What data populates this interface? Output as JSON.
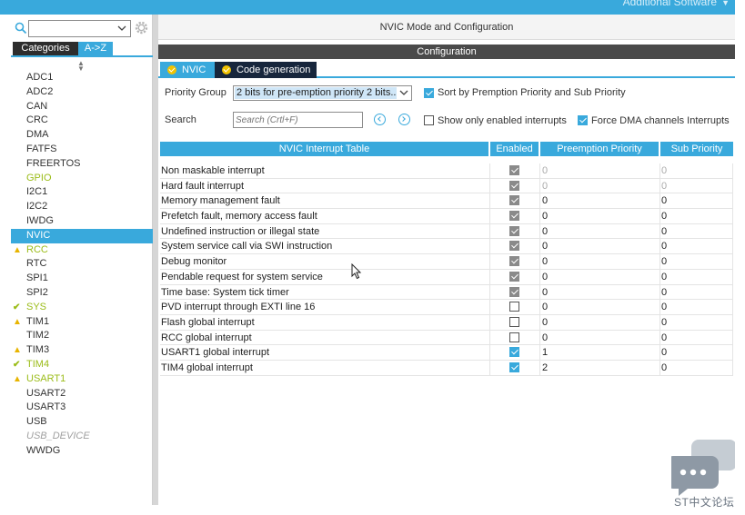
{
  "top_bar": {
    "ghost_text": "Additional Software"
  },
  "left_panel": {
    "search_value": "",
    "tabs": [
      {
        "label": "Categories",
        "active": false
      },
      {
        "label": "A->Z",
        "active": true
      }
    ],
    "peripherals": [
      {
        "label": "ADC1",
        "status": "none"
      },
      {
        "label": "ADC2",
        "status": "none"
      },
      {
        "label": "CAN",
        "status": "none"
      },
      {
        "label": "CRC",
        "status": "none"
      },
      {
        "label": "DMA",
        "status": "none"
      },
      {
        "label": "FATFS",
        "status": "none"
      },
      {
        "label": "FREERTOS",
        "status": "none"
      },
      {
        "label": "GPIO",
        "status": "green"
      },
      {
        "label": "I2C1",
        "status": "none"
      },
      {
        "label": "I2C2",
        "status": "none"
      },
      {
        "label": "IWDG",
        "status": "none"
      },
      {
        "label": "NVIC",
        "status": "selected"
      },
      {
        "label": "RCC",
        "status": "warn"
      },
      {
        "label": "RTC",
        "status": "none"
      },
      {
        "label": "SPI1",
        "status": "none"
      },
      {
        "label": "SPI2",
        "status": "none"
      },
      {
        "label": "SYS",
        "status": "ok"
      },
      {
        "label": "TIM1",
        "status": "warn-dark"
      },
      {
        "label": "TIM2",
        "status": "none"
      },
      {
        "label": "TIM3",
        "status": "warn-dark"
      },
      {
        "label": "TIM4",
        "status": "ok"
      },
      {
        "label": "USART1",
        "status": "warn"
      },
      {
        "label": "USART2",
        "status": "none"
      },
      {
        "label": "USART3",
        "status": "none"
      },
      {
        "label": "USB",
        "status": "none"
      },
      {
        "label": "USB_DEVICE",
        "status": "disabled"
      },
      {
        "label": "WWDG",
        "status": "none"
      }
    ]
  },
  "main": {
    "title": "NVIC Mode and Configuration",
    "config_label": "Configuration",
    "tabs": [
      {
        "label": "NVIC"
      },
      {
        "label": "Code generation"
      }
    ],
    "priority_group_label": "Priority Group",
    "priority_group_value": "2 bits for pre-emption priority 2 bits...",
    "sort_label": "Sort by Premption Priority and Sub Priority",
    "sort_checked": true,
    "search_label": "Search",
    "search_placeholder": "Search (Crtl+F)",
    "show_enabled_label": "Show only enabled interrupts",
    "show_enabled_checked": false,
    "force_dma_label": "Force DMA channels Interrupts",
    "force_dma_checked": true
  },
  "table": {
    "headers": [
      "NVIC Interrupt Table",
      "Enabled",
      "Preemption Priority",
      "Sub Priority"
    ],
    "rows": [
      {
        "name": "Non maskable interrupt",
        "enabled": "locked",
        "preemption": "0",
        "sub": "0",
        "dim": true
      },
      {
        "name": "Hard fault interrupt",
        "enabled": "locked",
        "preemption": "0",
        "sub": "0",
        "dim": true
      },
      {
        "name": "Memory management fault",
        "enabled": "locked",
        "preemption": "0",
        "sub": "0",
        "dim": false
      },
      {
        "name": "Prefetch fault, memory access fault",
        "enabled": "locked",
        "preemption": "0",
        "sub": "0",
        "dim": false
      },
      {
        "name": "Undefined instruction or illegal state",
        "enabled": "locked",
        "preemption": "0",
        "sub": "0",
        "dim": false
      },
      {
        "name": "System service call via SWI instruction",
        "enabled": "locked",
        "preemption": "0",
        "sub": "0",
        "dim": false
      },
      {
        "name": "Debug monitor",
        "enabled": "locked",
        "preemption": "0",
        "sub": "0",
        "dim": false
      },
      {
        "name": "Pendable request for system service",
        "enabled": "locked",
        "preemption": "0",
        "sub": "0",
        "dim": false
      },
      {
        "name": "Time base: System tick timer",
        "enabled": "locked",
        "preemption": "0",
        "sub": "0",
        "dim": false
      },
      {
        "name": "PVD interrupt through EXTI line 16",
        "enabled": "off",
        "preemption": "0",
        "sub": "0",
        "dim": false
      },
      {
        "name": "Flash global interrupt",
        "enabled": "off",
        "preemption": "0",
        "sub": "0",
        "dim": false
      },
      {
        "name": "RCC global interrupt",
        "enabled": "off",
        "preemption": "0",
        "sub": "0",
        "dim": false
      },
      {
        "name": "USART1 global interrupt",
        "enabled": "on",
        "preemption": "1",
        "sub": "0",
        "dim": false
      },
      {
        "name": "TIM4 global interrupt",
        "enabled": "on",
        "preemption": "2",
        "sub": "0",
        "dim": false
      }
    ]
  },
  "watermark": {
    "text": "ST中文论坛"
  },
  "colors": {
    "accent": "#39a9dc",
    "warn": "#e8b400",
    "ok": "#9bbc18",
    "dark_tab": "#17263c"
  }
}
